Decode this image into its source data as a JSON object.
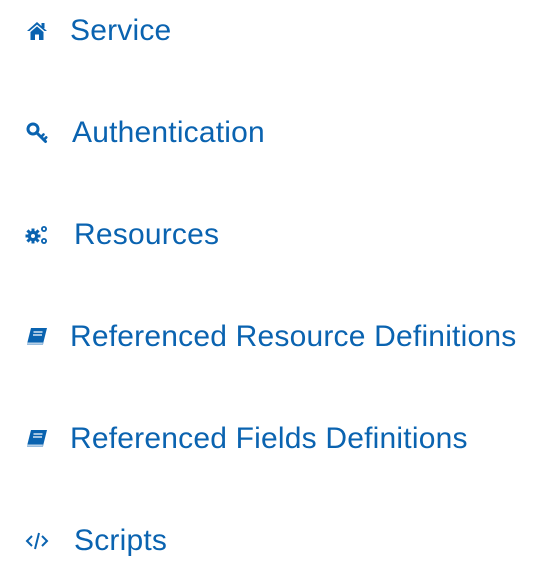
{
  "nav": {
    "accent_color": "#0a63b0",
    "items": [
      {
        "label": "Service",
        "icon": "home-icon"
      },
      {
        "label": "Authentication",
        "icon": "key-icon"
      },
      {
        "label": "Resources",
        "icon": "cogs-icon"
      },
      {
        "label": "Referenced Resource Definitions",
        "icon": "book-icon"
      },
      {
        "label": "Referenced Fields Definitions",
        "icon": "book-icon"
      },
      {
        "label": "Scripts",
        "icon": "code-icon"
      }
    ]
  }
}
